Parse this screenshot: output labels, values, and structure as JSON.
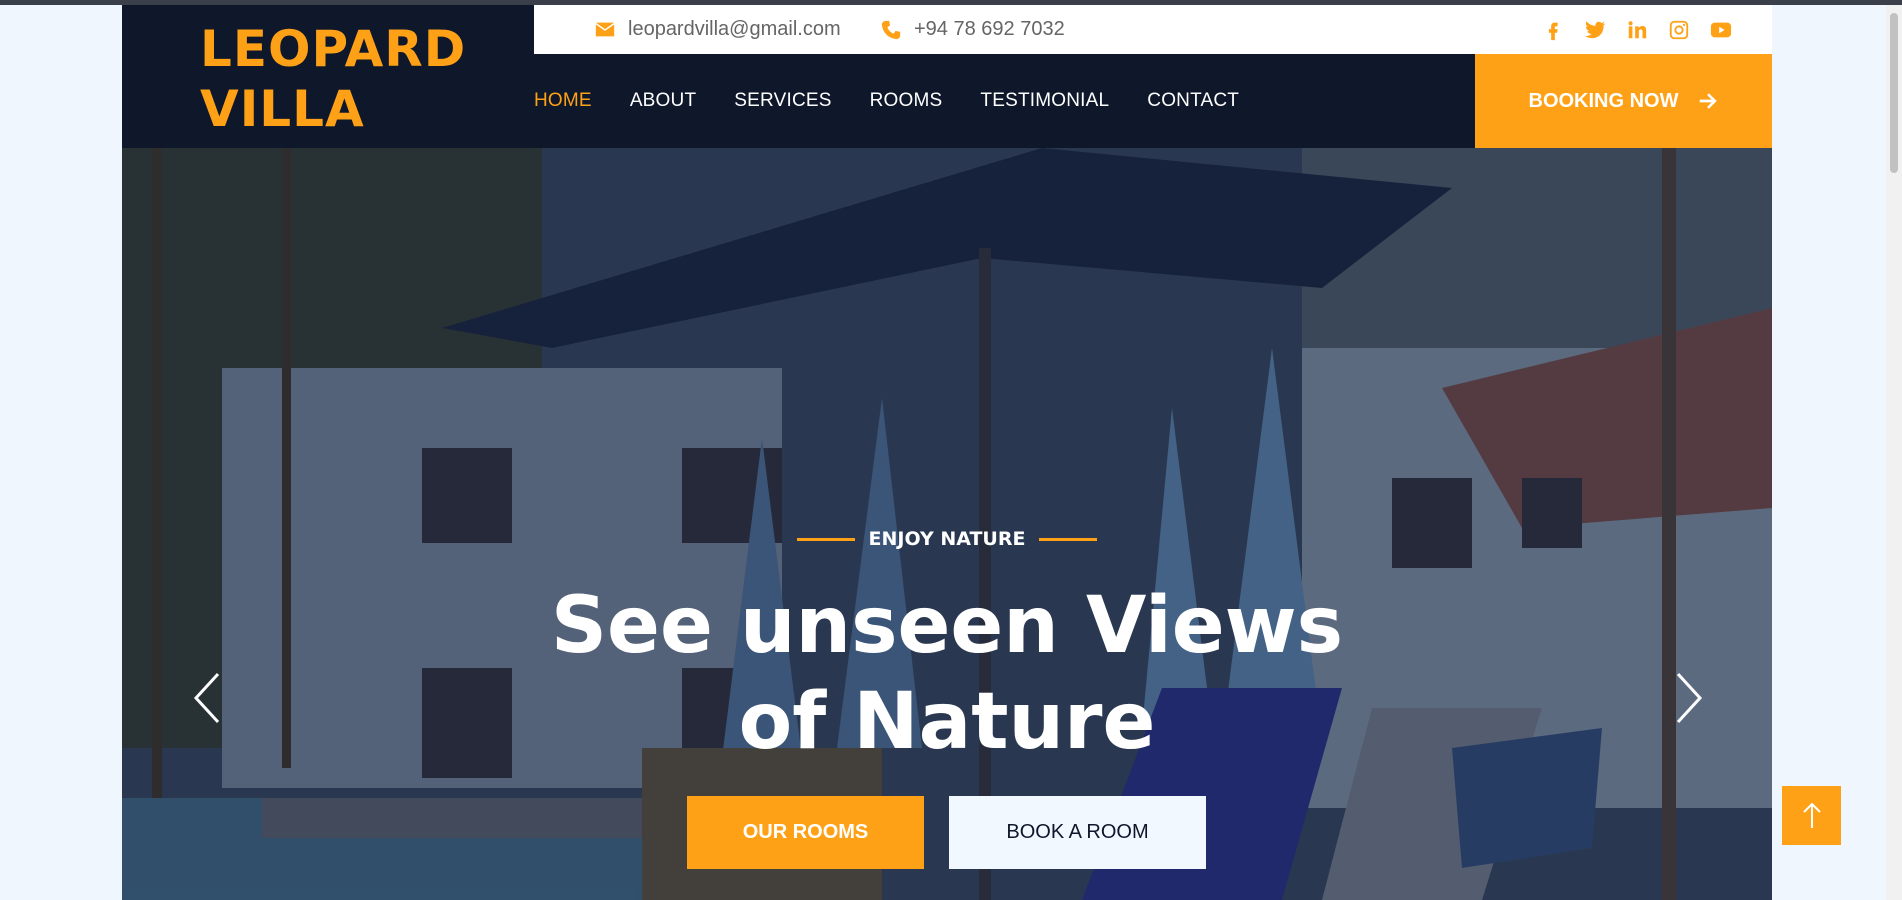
{
  "brand": {
    "line1": "LEOPARD",
    "line2": "VILLA",
    "color": "#fea116"
  },
  "topbar": {
    "email": "leopardvilla@gmail.com",
    "phone": "+94 78 692 7032",
    "icons": [
      "envelope-icon",
      "phone-icon"
    ],
    "social": [
      "facebook-icon",
      "twitter-icon",
      "linkedin-icon",
      "instagram-icon",
      "youtube-icon"
    ]
  },
  "nav": {
    "items": [
      {
        "label": "HOME",
        "active": true
      },
      {
        "label": "ABOUT"
      },
      {
        "label": "SERVICES"
      },
      {
        "label": "ROOMS"
      },
      {
        "label": "TESTIMONIAL"
      },
      {
        "label": "CONTACT"
      }
    ],
    "booking_label": "BOOKING NOW"
  },
  "hero": {
    "eyebrow": "ENJOY NATURE",
    "title_line1": "See unseen Views",
    "title_line2": "of Nature",
    "primary_button": "OUR ROOMS",
    "secondary_button": "BOOK A ROOM"
  },
  "colors": {
    "accent": "#fea116",
    "dark": "#0f172b",
    "light": "#f1f8ff"
  }
}
